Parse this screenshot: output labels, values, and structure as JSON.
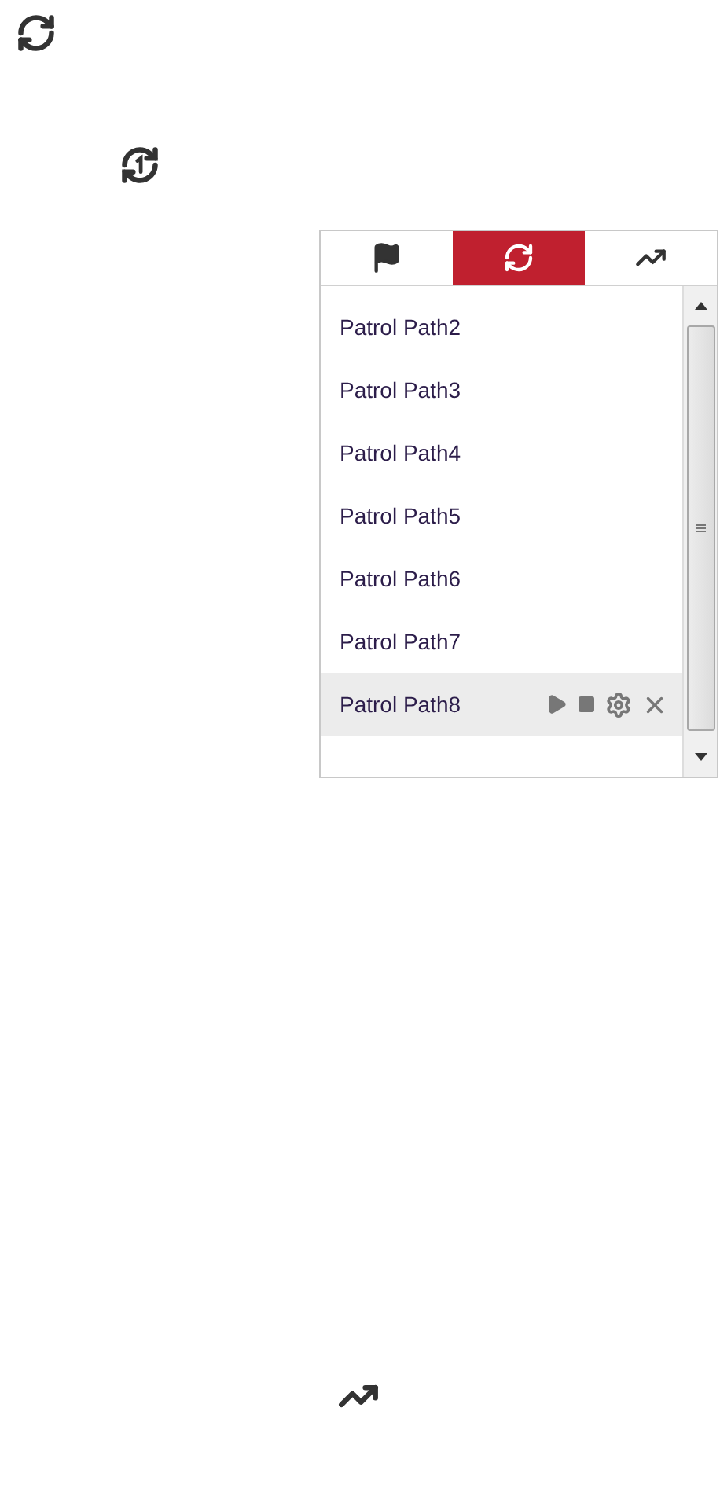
{
  "tabs": [
    {
      "selected": false
    },
    {
      "selected": true
    },
    {
      "selected": false
    }
  ],
  "patrol_paths": [
    {
      "name": "Patrol Path2",
      "selected": false
    },
    {
      "name": "Patrol Path3",
      "selected": false
    },
    {
      "name": "Patrol Path4",
      "selected": false
    },
    {
      "name": "Patrol Path5",
      "selected": false
    },
    {
      "name": "Patrol Path6",
      "selected": false
    },
    {
      "name": "Patrol Path7",
      "selected": false
    },
    {
      "name": "Patrol Path8",
      "selected": true
    }
  ]
}
